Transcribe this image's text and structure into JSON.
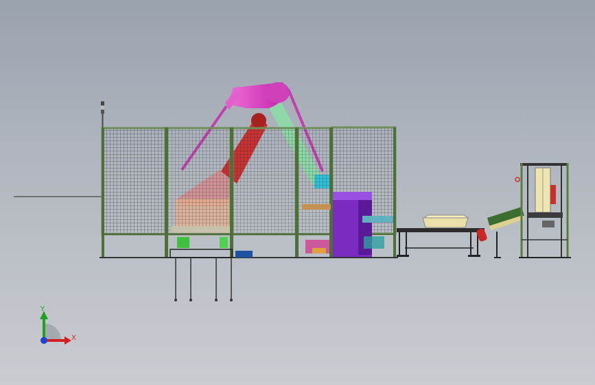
{
  "viewport": {
    "background_top": "#9aa2ae",
    "background_bottom": "#c9ccd1"
  },
  "triad": {
    "x_label": "X",
    "y_label": "Y",
    "x_color": "#d22020",
    "y_color": "#22a022",
    "z_color": "#2040d0"
  },
  "scene": {
    "components": [
      "safety-fence",
      "robot-arm",
      "stack-light",
      "control-cabinet",
      "roller-conveyor",
      "bag-on-conveyor",
      "inclined-conveyor",
      "bag-feeder-frame"
    ],
    "colors": {
      "fence_frame": "#6e8f5a",
      "robot_magenta": "#e040c8",
      "robot_red": "#c83232",
      "cabinet_purple": "#7a2cc0",
      "conveyor_green": "#3c6e32"
    }
  }
}
